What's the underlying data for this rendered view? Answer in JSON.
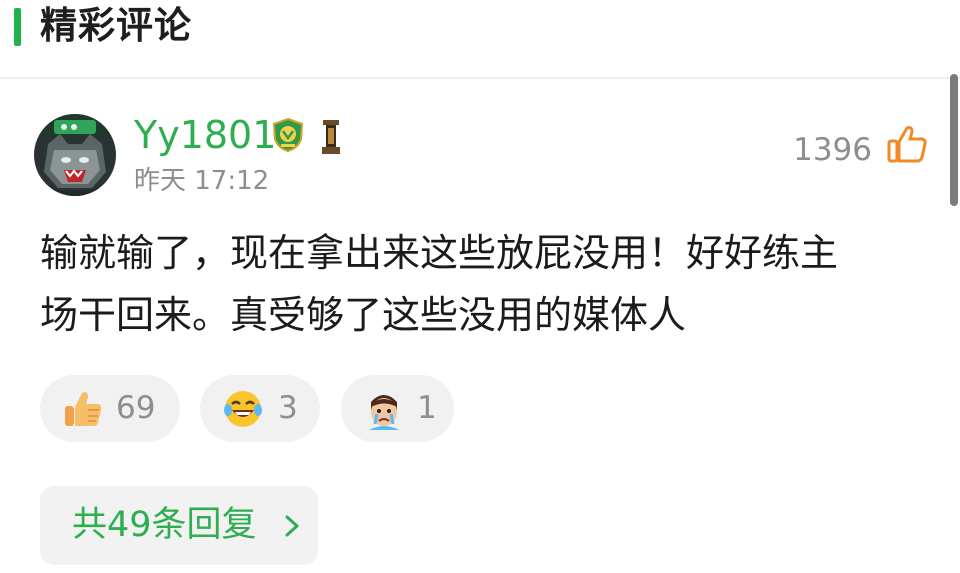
{
  "section": {
    "title": "精彩评论",
    "accent_color": "#22b24c"
  },
  "comment": {
    "username": "Yy1801",
    "username_color": "#2eae4f",
    "timestamp": "昨天 17:12",
    "like_count": "1396",
    "text_line1": "输就输了，现在拿出来这些放屁没用！好好练主",
    "text_line2": "场干回来。真受够了这些没用的媒体人",
    "badges": [
      "club-shield-badge",
      "trophy-badge"
    ],
    "avatar": "wolf-avatar"
  },
  "reactions": [
    {
      "icon": "thumbs-up-emoji",
      "count": "69"
    },
    {
      "icon": "laughing-crying-emoji",
      "count": "3"
    },
    {
      "icon": "crying-face-emoji",
      "count": "1"
    }
  ],
  "replies": {
    "label": "共49条回复",
    "icon": "chevron-right-icon"
  }
}
